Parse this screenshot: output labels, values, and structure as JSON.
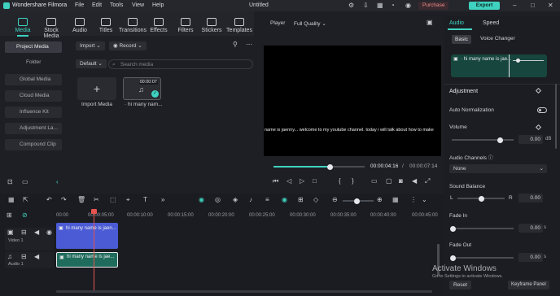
{
  "app": {
    "name": "Wondershare Filmora",
    "project": "Untitled"
  },
  "menu": [
    "File",
    "Edit",
    "Tools",
    "View",
    "Help"
  ],
  "purchase_label": "Purchase",
  "export_label": "Export",
  "tools": [
    "Media",
    "Stock Media",
    "Audio",
    "Titles",
    "Transitions",
    "Effects",
    "Filters",
    "Stickers",
    "Templates"
  ],
  "sidebar": {
    "project_media": "Project Media",
    "folder": "Folder",
    "items": [
      "Global Media",
      "Cloud Media",
      "Influence Kit",
      "Adjustment La...",
      "Compound Clip"
    ]
  },
  "media": {
    "import_label": "Import",
    "record_label": "Record",
    "default_label": "Default",
    "search_placeholder": "Search media",
    "import_media_label": "Import Media",
    "clip_name": "hi many nam...",
    "clip_duration": "00:00:07"
  },
  "player": {
    "label": "Player",
    "quality": "Full Quality",
    "subtitle": "name is jaenny... welcome to my youtube channel. today i will talk about how to make",
    "current_time": "00:00:04:16",
    "total_time": "00:00:07:14",
    "progress": 0.62
  },
  "right_panel": {
    "tabs": [
      "Audio",
      "Speed"
    ],
    "subtabs": [
      "Basic",
      "Voice Changer"
    ],
    "clip_label": "hi many name is jae...",
    "adjustment": "Adjustment",
    "auto_normalization": "Auto Normalization",
    "volume_label": "Volume",
    "volume_value": "0.00",
    "volume_unit": "dB",
    "audio_channels_label": "Audio Channels",
    "audio_channels_value": "None",
    "sound_balance_label": "Sound Balance",
    "balance_left": "L",
    "balance_right": "R",
    "balance_value": "0.00",
    "fade_in_label": "Fade In",
    "fade_in_value": "0.00",
    "fade_in_unit": "s",
    "fade_out_label": "Fade Out",
    "fade_out_value": "0.00",
    "fade_out_unit": "s",
    "reset_label": "Reset",
    "keyframe_label": "Keyframe Panel"
  },
  "timeline": {
    "ticks": [
      "00:00",
      "00:00:05:00",
      "00:00:10:00",
      "00:00:15:00",
      "00:00:20:00",
      "00:00:25:00",
      "00:00:30:00",
      "00:00:35:00",
      "00:00:40:00",
      "00:00:45:00"
    ],
    "video_track_label": "Video 1",
    "audio_track_label": "Audio 1",
    "video_clip_label": "hi many name is jaen...",
    "audio_clip_label": "hi many name is jae..."
  },
  "watermark": {
    "line1": "Activate Windows",
    "line2": "Go to Settings to activate Windows."
  },
  "colors": {
    "accent": "#3fd2c0",
    "clip_blue": "#4b5bd6",
    "audio_green": "#1f6b5c",
    "playhead": "#e8534f"
  }
}
